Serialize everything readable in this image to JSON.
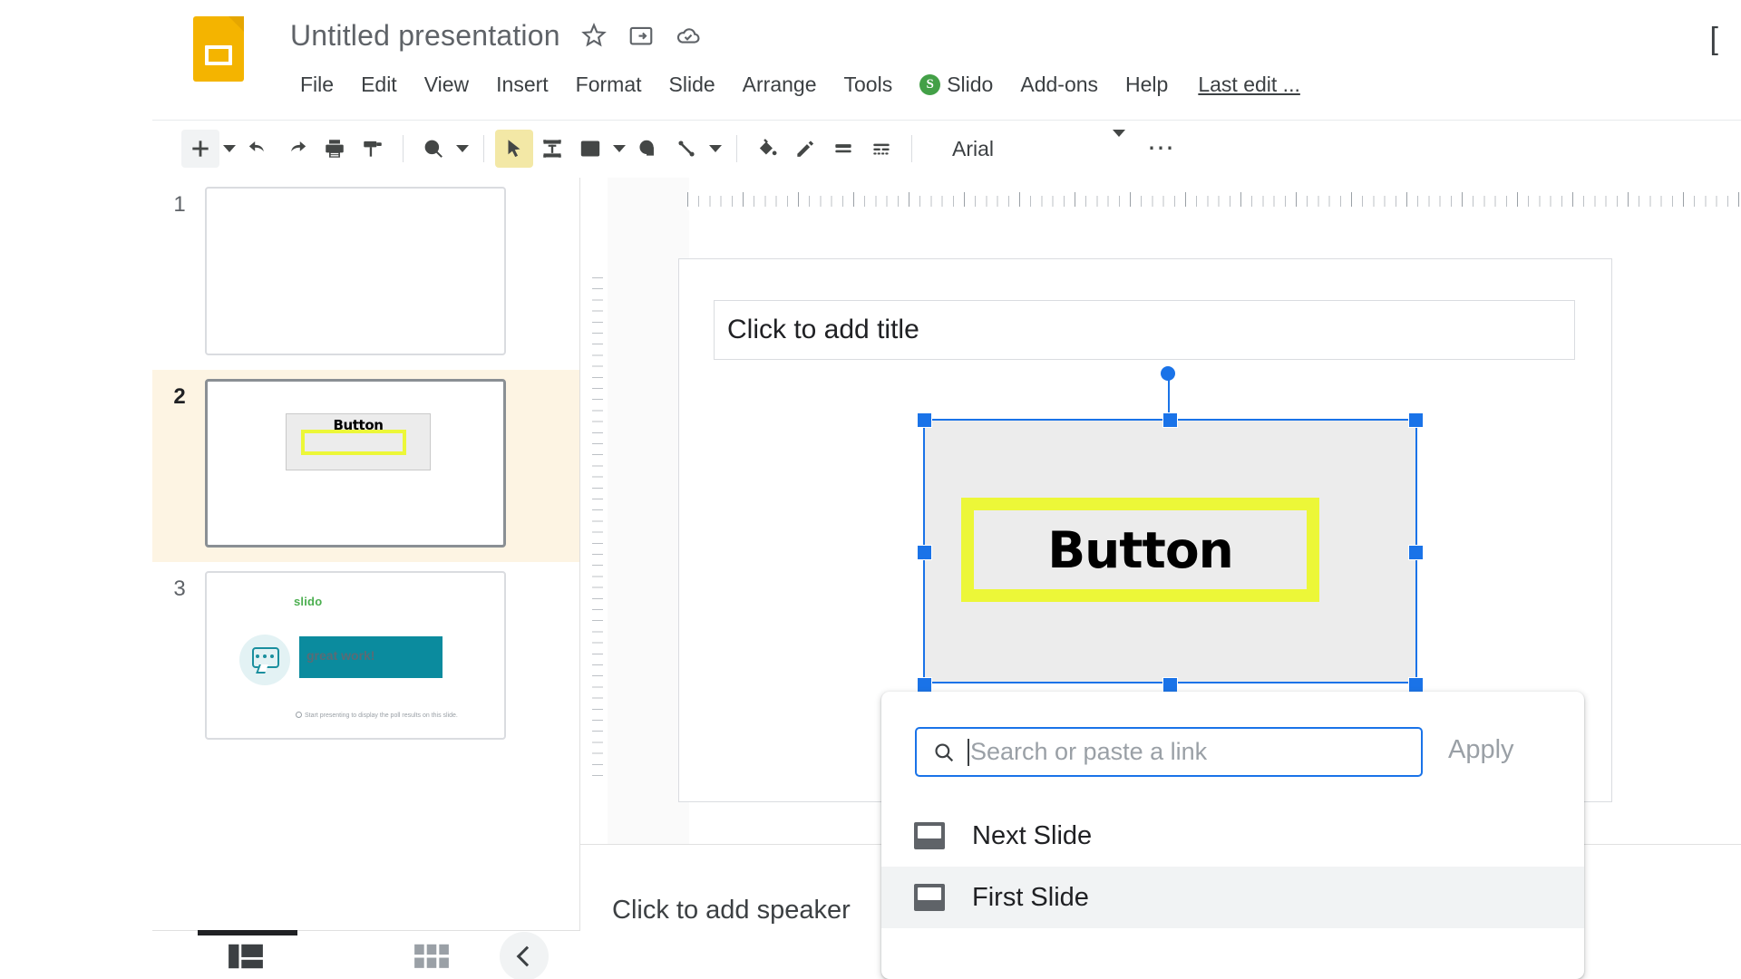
{
  "app": {
    "name": "Google Slides",
    "logo_icon": "slides-logo-icon"
  },
  "header": {
    "doc_title": "Untitled presentation",
    "star_icon": "star-icon",
    "move_to_folder_icon": "move-to-folder-icon",
    "cloud_status_icon": "cloud-saved-icon",
    "last_edit": "Last edit ...",
    "menus": [
      {
        "label": "File"
      },
      {
        "label": "Edit"
      },
      {
        "label": "View"
      },
      {
        "label": "Insert"
      },
      {
        "label": "Format"
      },
      {
        "label": "Slide"
      },
      {
        "label": "Arrange"
      },
      {
        "label": "Tools"
      },
      {
        "label": "Slido",
        "badge": "S",
        "badge_color": "#43A047"
      },
      {
        "label": "Add-ons"
      },
      {
        "label": "Help"
      }
    ]
  },
  "toolbar": {
    "new_slide_icon": "plus-icon",
    "new_slide_caret_icon": "chevron-down-icon",
    "undo_icon": "undo-icon",
    "redo_icon": "redo-icon",
    "print_icon": "print-icon",
    "paint_format_icon": "paint-format-icon",
    "zoom_icon": "zoom-in-icon",
    "zoom_caret_icon": "chevron-down-icon",
    "select_icon": "cursor-select-icon",
    "textbox_icon": "text-box-icon",
    "image_icon": "insert-image-icon",
    "image_caret_icon": "chevron-down-icon",
    "shape_icon": "shape-icon",
    "line_icon": "line-icon",
    "line_caret_icon": "chevron-down-icon",
    "fill_color_icon": "fill-color-icon",
    "border_color_icon": "border-color-icon",
    "border_weight_icon": "border-weight-icon",
    "border_dash_icon": "border-dash-icon",
    "font_name": "Arial",
    "font_caret_icon": "chevron-down-icon",
    "more_icon": "more-options-icon"
  },
  "filmstrip": {
    "slides": [
      {
        "number": "1",
        "selected": false
      },
      {
        "number": "2",
        "selected": true,
        "button_label": "Button"
      },
      {
        "number": "3",
        "selected": false,
        "slido_logo": "slido",
        "poll_text": "great work!",
        "footer_note": "Start presenting to display the poll results on this slide.",
        "bubble_icon": "speech-bubble-icon",
        "bar_color": "#0b8b9e"
      }
    ]
  },
  "canvas": {
    "title_placeholder": "Click to add title",
    "selected_shape": {
      "text": "Button",
      "fill_color": "#ececec",
      "border_color": "#ecf738",
      "selection_color": "#1a73e8",
      "rotate_handle_icon": "rotate-handle-icon"
    }
  },
  "notes": {
    "placeholder": "Click to add speaker"
  },
  "link_dialog": {
    "search_icon": "search-icon",
    "search_placeholder": "Search or paste a link",
    "search_value": "",
    "apply_label": "Apply",
    "items": [
      {
        "label": "Next Slide",
        "icon": "slide-icon",
        "hover": false
      },
      {
        "label": "First Slide",
        "icon": "slide-icon",
        "hover": true
      }
    ]
  },
  "bottom_bar": {
    "filmstrip_view_icon": "filmstrip-view-icon",
    "grid_view_icon": "grid-view-icon",
    "collapse_icon": "chevron-left-icon"
  }
}
